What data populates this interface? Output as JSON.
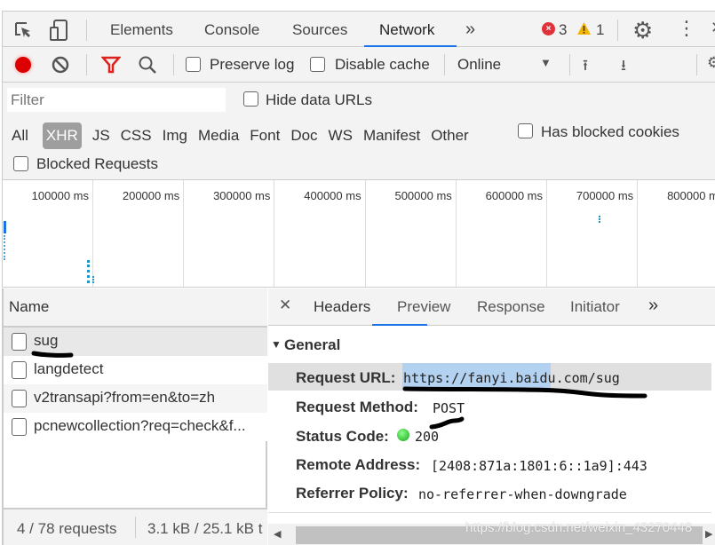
{
  "tabs": [
    "Elements",
    "Console",
    "Sources",
    "Network"
  ],
  "active_tab": "Network",
  "errors": "3",
  "warnings": "1",
  "toolbar": {
    "preserve_log": "Preserve log",
    "disable_cache": "Disable cache",
    "throttle": "Online"
  },
  "filter": {
    "placeholder": "Filter",
    "hide_data_urls": "Hide data URLs",
    "types": [
      "All",
      "XHR",
      "JS",
      "CSS",
      "Img",
      "Media",
      "Font",
      "Doc",
      "WS",
      "Manifest",
      "Other"
    ],
    "active_type": "XHR",
    "has_blocked_cookies": "Has blocked cookies",
    "blocked_requests": "Blocked Requests"
  },
  "timeline": {
    "ticks": [
      "100000 ms",
      "200000 ms",
      "300000 ms",
      "400000 ms",
      "500000 ms",
      "600000 ms",
      "700000 ms",
      "800000 ms"
    ]
  },
  "requests": {
    "header": "Name",
    "items": [
      "sug",
      "langdetect",
      "v2transapi?from=en&to=zh",
      "pcnewcollection?req=check&f..."
    ],
    "selected": "sug"
  },
  "status": {
    "requests": "4 / 78 requests",
    "size": "3.1 kB / 25.1 kB t"
  },
  "detail": {
    "tabs": [
      "Headers",
      "Preview",
      "Response",
      "Initiator"
    ],
    "active": "Headers",
    "section": "General",
    "fields": [
      {
        "label": "Request URL:",
        "value": "https://fanyi.baidu.com/sug"
      },
      {
        "label": "Request Method:",
        "value": "POST"
      },
      {
        "label": "Status Code:",
        "value": "200"
      },
      {
        "label": "Remote Address:",
        "value": "[2408:871a:1801:6::1a9]:443"
      },
      {
        "label": "Referrer Policy:",
        "value": "no-referrer-when-downgrade"
      }
    ]
  },
  "watermark": "https://blog.csdn.net/weixin_43270448",
  "colors": {
    "accent": "#1a73e8",
    "record": "#d00",
    "status_ok": "#1aa51a",
    "url_highlight": "#b3d1f0"
  }
}
